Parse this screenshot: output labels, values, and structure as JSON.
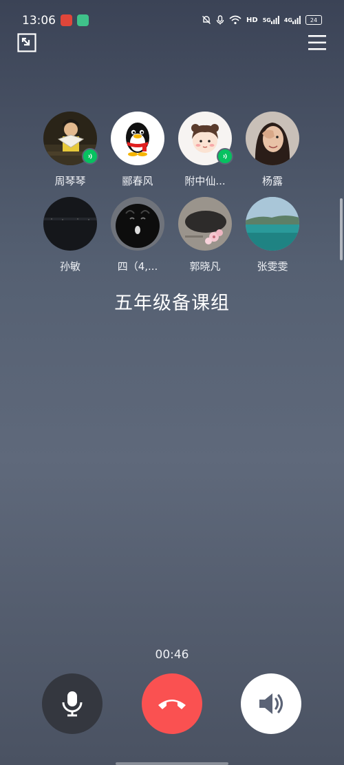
{
  "status_bar": {
    "time": "13:06",
    "hd_label": "HD",
    "net1": "5G",
    "net2": "4G",
    "battery": "24"
  },
  "call": {
    "group_name": "五年级备课组",
    "timer": "00:46"
  },
  "members": [
    {
      "name": "周琴琴",
      "speaking": true,
      "avatar": "photo-girl-fan"
    },
    {
      "name": "郦春风",
      "speaking": false,
      "avatar": "qq-penguin"
    },
    {
      "name": "附中仙...",
      "speaking": true,
      "avatar": "cartoon-girl"
    },
    {
      "name": "杨露",
      "speaking": false,
      "avatar": "photo-woman"
    },
    {
      "name": "孙敏",
      "speaking": false,
      "avatar": "dark-night"
    },
    {
      "name": "四（4,...",
      "speaking": false,
      "avatar": "black-cartoon"
    },
    {
      "name": "郭晓凡",
      "speaking": false,
      "avatar": "flowers-stone"
    },
    {
      "name": "张雯雯",
      "speaking": false,
      "avatar": "sea-landscape"
    }
  ],
  "controls": {
    "mic": "microphone-icon",
    "hangup": "hangup-icon",
    "speaker": "speaker-icon"
  },
  "colors": {
    "hangup": "#fa5151",
    "speaking": "#07c160",
    "mic_bg": "#34373f"
  }
}
